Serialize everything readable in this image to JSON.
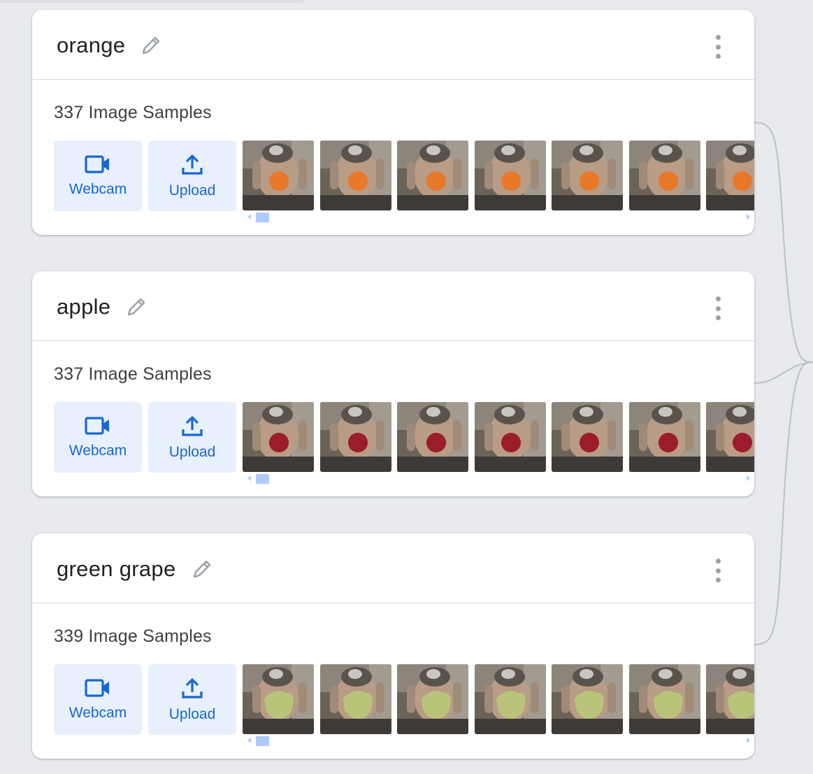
{
  "classes": [
    {
      "name": "orange",
      "sample_count": "337 Image Samples",
      "webcam_label": "Webcam",
      "upload_label": "Upload",
      "fruit_color": "#e8782a"
    },
    {
      "name": "apple",
      "sample_count": "337 Image Samples",
      "webcam_label": "Webcam",
      "upload_label": "Upload",
      "fruit_color": "#9b1c2a"
    },
    {
      "name": "green grape",
      "sample_count": "339 Image Samples",
      "webcam_label": "Webcam",
      "upload_label": "Upload",
      "fruit_color": "#b9c47a"
    }
  ],
  "thumbnails_visible_per_class": 7,
  "colors": {
    "accent": "#1967d2",
    "button_bg": "#e8f0fe",
    "scroll": "#aecbfa",
    "background": "#e8eaed"
  },
  "icons": {
    "edit": "pencil-icon",
    "more": "more-vert-icon",
    "webcam": "videocam-icon",
    "upload": "upload-icon"
  }
}
